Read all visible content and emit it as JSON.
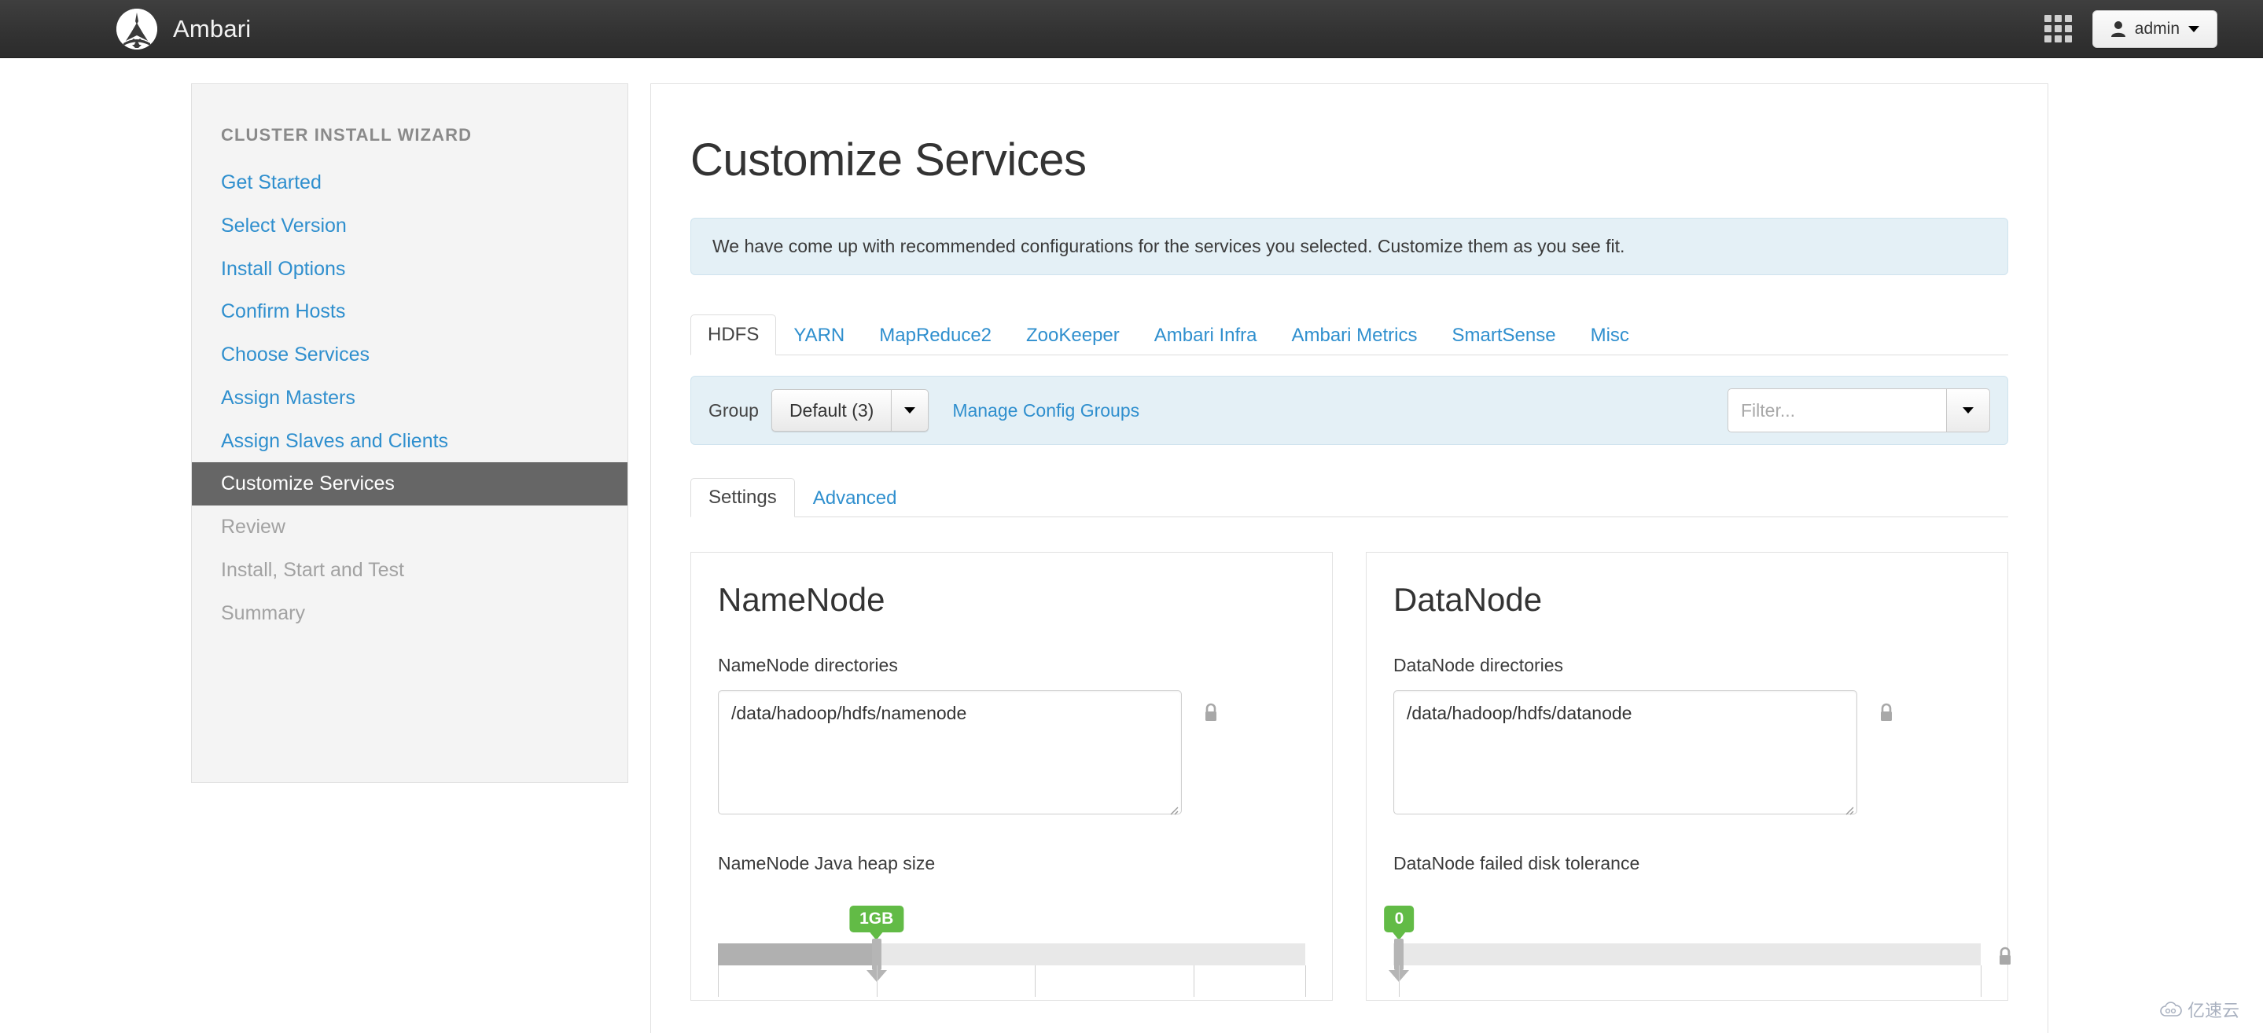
{
  "navbar": {
    "brand": "Ambari",
    "grid_icon": "grid-apps-icon",
    "user_button": {
      "label": "admin",
      "icon": "user-icon",
      "caret": "caret-down-icon"
    }
  },
  "sidebar": {
    "title": "CLUSTER INSTALL WIZARD",
    "items": [
      {
        "label": "Get Started",
        "state": "link"
      },
      {
        "label": "Select Version",
        "state": "link"
      },
      {
        "label": "Install Options",
        "state": "link"
      },
      {
        "label": "Confirm Hosts",
        "state": "link"
      },
      {
        "label": "Choose Services",
        "state": "link"
      },
      {
        "label": "Assign Masters",
        "state": "link"
      },
      {
        "label": "Assign Slaves and Clients",
        "state": "link"
      },
      {
        "label": "Customize Services",
        "state": "active"
      },
      {
        "label": "Review",
        "state": "disabled"
      },
      {
        "label": "Install, Start and Test",
        "state": "disabled"
      },
      {
        "label": "Summary",
        "state": "disabled"
      }
    ]
  },
  "main": {
    "title": "Customize Services",
    "alert": "We have come up with recommended configurations for the services you selected. Customize them as you see fit.",
    "tabs": [
      {
        "label": "HDFS",
        "active": true
      },
      {
        "label": "YARN",
        "active": false
      },
      {
        "label": "MapReduce2",
        "active": false
      },
      {
        "label": "ZooKeeper",
        "active": false
      },
      {
        "label": "Ambari Infra",
        "active": false
      },
      {
        "label": "Ambari Metrics",
        "active": false
      },
      {
        "label": "SmartSense",
        "active": false
      },
      {
        "label": "Misc",
        "active": false
      }
    ],
    "group_bar": {
      "label": "Group",
      "selected_group": "Default (3)",
      "dropdown_icon": "caret-down-icon",
      "manage_link": "Manage Config Groups",
      "filter_placeholder": "Filter...",
      "filter_value": "",
      "filter_dropdown_icon": "caret-down-icon"
    },
    "subtabs": [
      {
        "label": "Settings",
        "active": true
      },
      {
        "label": "Advanced",
        "active": false
      }
    ],
    "panels": [
      {
        "title": "NameNode",
        "dir_label": "NameNode directories",
        "dir_value": "/data/hadoop/hdfs/namenode",
        "lock_icon": "lock-icon",
        "slider_label": "NameNode Java heap size",
        "slider_value": "1GB",
        "slider_percent": 27
      },
      {
        "title": "DataNode",
        "dir_label": "DataNode directories",
        "dir_value": "/data/hadoop/hdfs/datanode",
        "lock_icon": "lock-icon",
        "slider_label": "DataNode failed disk tolerance",
        "slider_value": "0",
        "slider_percent": 0
      }
    ]
  },
  "watermark": {
    "text": "亿速云",
    "icon": "cloud-icon"
  },
  "colors": {
    "link": "#2f8fce",
    "navbar_bg": "#333333",
    "active_nav_bg": "#666666",
    "info_bg": "#e4f0f6",
    "slider_badge": "#62bb46"
  }
}
